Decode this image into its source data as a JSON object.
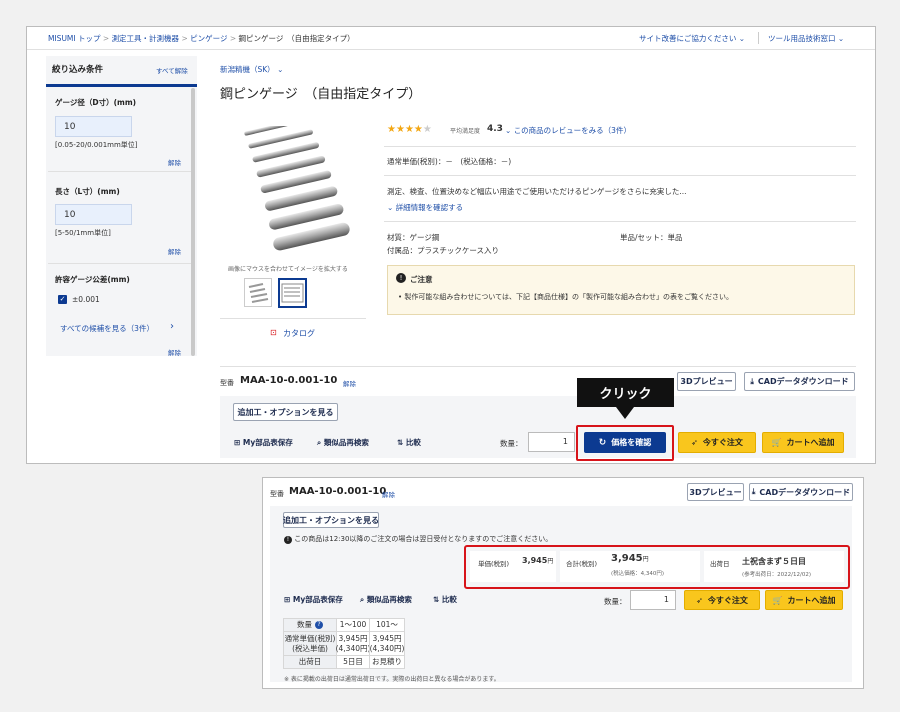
{
  "breadcrumb": {
    "items": [
      "MISUMI トップ",
      "測定工具・計測機器",
      "ピンゲージ",
      "鋼ピンゲージ　（自由指定タイプ）"
    ],
    "sep": ">"
  },
  "header_links": {
    "improve": "サイト改善にご協力ください",
    "tech": "ツール用品技術窓口"
  },
  "sidebar": {
    "title": "絞り込み条件",
    "clear_all": "すべて解除",
    "gauge_dia_label": "ゲージ径（D寸）(mm)",
    "gauge_dia_value": "10",
    "gauge_dia_hint": "[0.05-20/0.001mm単位]",
    "length_label": "長さ（L寸）(mm)",
    "length_value": "10",
    "length_hint": "[5-50/1mm単位]",
    "tolerance_label": "許容ゲージ公差(mm)",
    "tolerance_option": "±0.001",
    "see_all": "すべての候補を見る（3件）",
    "clear": "解除"
  },
  "product": {
    "maker": "新潟精機（SK）",
    "title": "鋼ピンゲージ　（自由指定タイプ）",
    "rating_label": "平均満足度",
    "rating_value": "4.3",
    "review_link": "この商品のレビューをみる（3件）",
    "price_line": "通常単価(税別)：－　(税込価格：－)",
    "description": "測定、検査、位置決めなど幅広い用途でご使用いただけるピンゲージをさらに充実した...",
    "detail_link": "詳細情報を確認する",
    "material": "材質：ゲージ鋼",
    "unit": "単品/セット：単品",
    "accessory": "付属品：プラスチックケース入り",
    "image_hint": "画像にマウスを合わせてイメージを拡大する",
    "catalog": "カタログ",
    "notice_title": "ご注意",
    "notice_text": "製作可能な組み合わせについては、下記【商品仕様】の「製作可能な組み合わせ」の表をご覧ください。"
  },
  "order": {
    "model_label": "型番",
    "model": "MAA-10-0.001-10",
    "clear": "解除",
    "preview_3d": "3Dプレビュー",
    "cad": "CADデータダウンロード",
    "options": "追加工・オプションを見る",
    "my_parts": "My部品表保存",
    "similar": "類似品再検索",
    "compare": "比較",
    "qty_label": "数量：",
    "qty": "1",
    "check_price": "価格を確認",
    "order_now": "今すぐ注文",
    "add_cart": "カートへ追加"
  },
  "callout": "クリック",
  "result": {
    "notice": "この商品は12:30以降のご注文の場合は翌日受付となりますのでご注意ください。",
    "unit_price_label": "単価(税別)",
    "unit_price": "3,945",
    "yen": "円",
    "total_label": "合計(税別)",
    "total": "3,945",
    "total_tax": "(税込価格：4,340円)",
    "ship_label": "出荷日",
    "ship_value": "土祝含まず５日目",
    "ship_ref": "(参考出荷日：2022/12/02)",
    "table": {
      "qty_header": "数量",
      "range1": "1～100",
      "range2": "101～",
      "price_header": "通常単価(税別)\n(税込単価)",
      "price1": "3,945円\n(4,340円)",
      "price2": "3,945円\n(4,340円)",
      "ship_header": "出荷日",
      "ship1": "5日目",
      "ship2": "お見積り"
    },
    "footnote": "※ 表に掲載の出荷日は通常出荷日です。実際の出荷日と異なる場合があります。"
  },
  "colors": {
    "accent_red": "#d7141a",
    "blue": "#0c3a91",
    "yellow": "#f9c61d",
    "link": "#1f4fa8"
  }
}
